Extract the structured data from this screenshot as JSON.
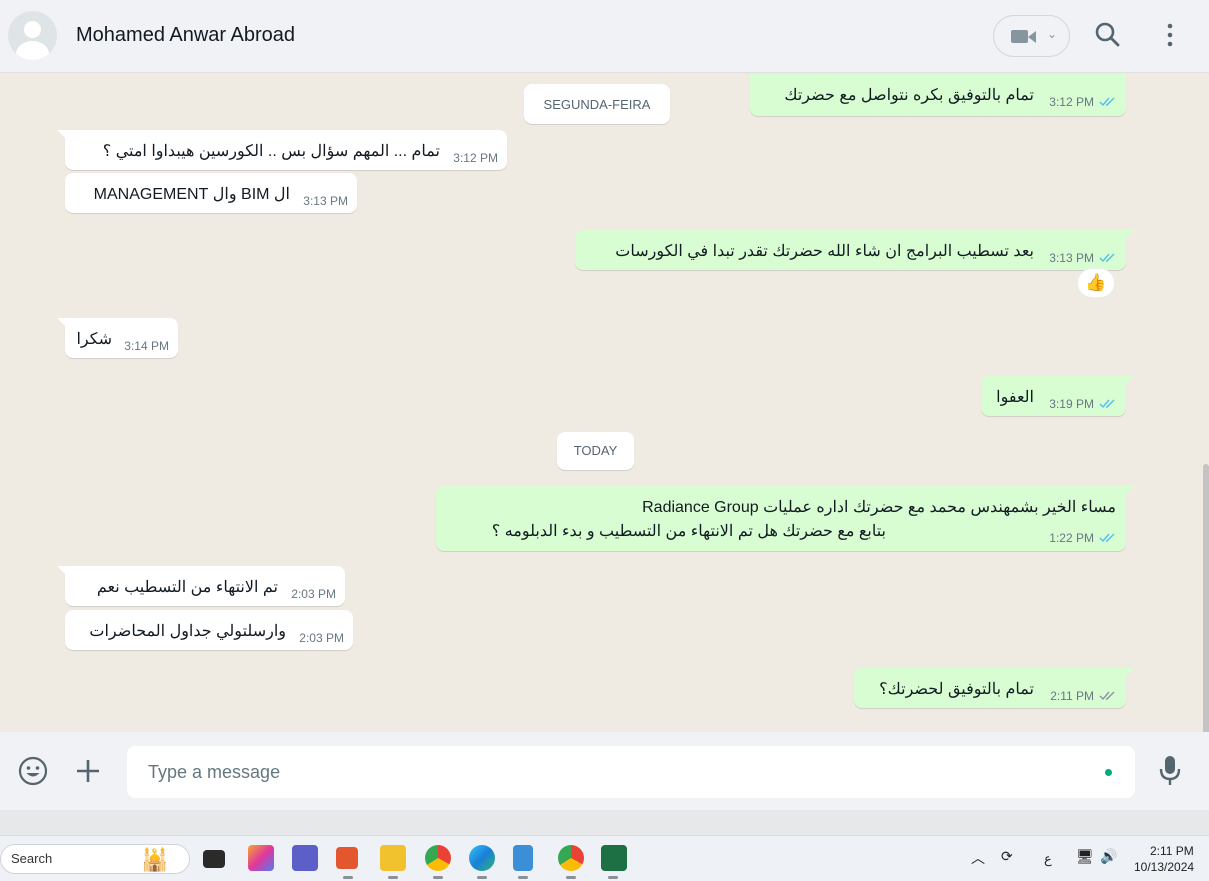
{
  "header": {
    "contact_name": "Mohamed Anwar Abroad"
  },
  "day_chips": {
    "monday": "SEGUNDA-FEIRA",
    "today": "TODAY"
  },
  "messages": [
    {
      "dir": "out",
      "text": "تمام بالتوفيق بكره نتواصل مع حضرتك",
      "time": "3:12 PM"
    },
    {
      "dir": "in",
      "text": "تمام ... المهم سؤال بس .. الكورسين هيبداوا امتي ؟",
      "time": "3:12 PM"
    },
    {
      "dir": "in",
      "text": "ال BIM وال  MANAGEMENT",
      "time": "3:13 PM"
    },
    {
      "dir": "out",
      "text": "بعد تسطيب البرامج ان شاء الله حضرتك تقدر تبدا في الكورسات",
      "time": "3:13 PM",
      "reaction": "👍"
    },
    {
      "dir": "in",
      "text": "شكرا",
      "time": "3:14 PM"
    },
    {
      "dir": "out",
      "text": "العفوا",
      "time": "3:19 PM"
    },
    {
      "dir": "out",
      "text_line1": "مساء  الخير بشمهندس محمد مع  حضرتك اداره عمليات Radiance Group",
      "text_line2": "بتابع مع حضرتك هل تم الانتهاء من التسطيب و بدء الدبلومه ؟",
      "time": "1:22 PM"
    },
    {
      "dir": "in",
      "text": "تم الانتهاء من التسطيب نعم",
      "time": "2:03 PM"
    },
    {
      "dir": "in",
      "text": "وارسلتولي جداول المحاضرات",
      "time": "2:03 PM"
    },
    {
      "dir": "out",
      "text": "تمام بالتوفيق لحضرتك؟",
      "time": "2:11 PM"
    }
  ],
  "composer": {
    "placeholder": "Type a message"
  },
  "taskbar": {
    "search_label": "Search",
    "tray_lang": "ع",
    "time": "2:11 PM",
    "date": "10/13/2024"
  },
  "colors": {
    "outgoing_bubble": "#d9fdd3",
    "incoming_bubble": "#ffffff",
    "chat_bg": "#efeae2",
    "read_ticks": "#53bdeb",
    "accent": "#00a884"
  },
  "icons": [
    "avatar-icon",
    "video-call-icon",
    "search-icon",
    "menu-icon",
    "emoji-icon",
    "plus-icon",
    "mic-icon",
    "read-ticks-icon",
    "thumbs-up-reaction"
  ]
}
